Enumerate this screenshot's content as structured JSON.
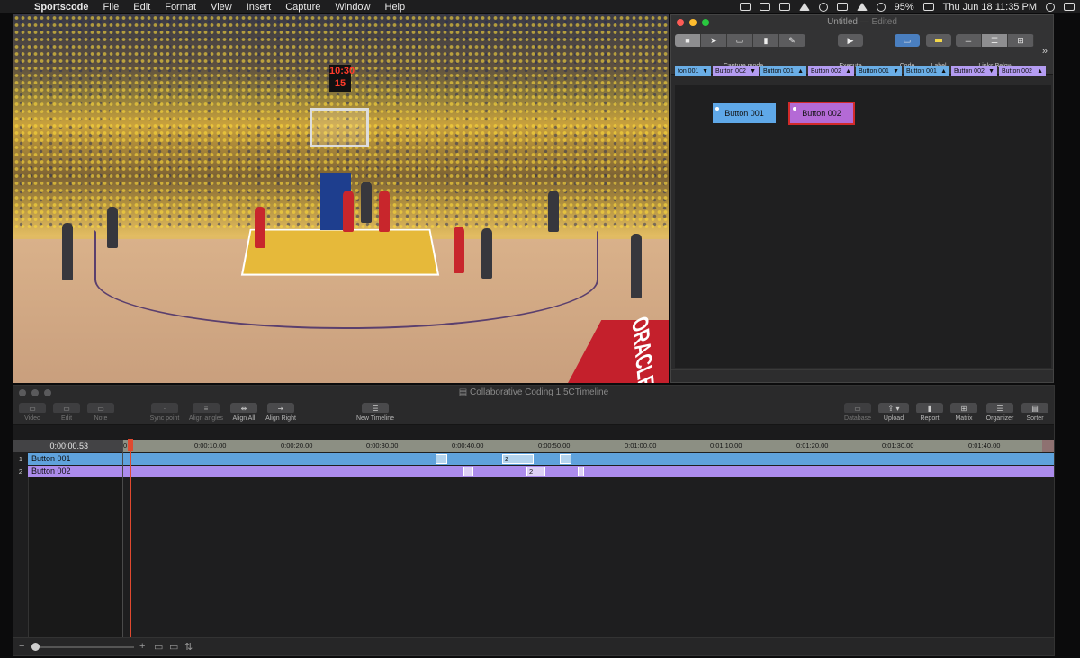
{
  "menubar": {
    "apple_glyph": "",
    "app_name": "Sportscode",
    "items": [
      "File",
      "Edit",
      "Format",
      "View",
      "Insert",
      "Capture",
      "Window",
      "Help"
    ],
    "battery": "95%",
    "datetime": "Thu Jun 18  11:35 PM"
  },
  "video": {
    "scoreboard_time": "10:30",
    "scoreboard_shot": "15",
    "ad_text": "ORACLE"
  },
  "code_window": {
    "title": "Untitled",
    "title_suffix": "— Edited",
    "toolbar": {
      "capture_mode_label": "Capture mode",
      "execute_label": "Execute",
      "code_label": "Code",
      "label_label": "Label",
      "links_below_label": "Links Below",
      "more_glyph": "»"
    },
    "tag_strip": [
      {
        "text": "ton 001",
        "arrow": "▼",
        "color": "blue"
      },
      {
        "text": "Button 002",
        "arrow": "▼",
        "color": "purple"
      },
      {
        "text": "Button 001",
        "arrow": "▲",
        "color": "blue"
      },
      {
        "text": "Button 002",
        "arrow": "▲",
        "color": "purple"
      },
      {
        "text": "Button 001",
        "arrow": "▼",
        "color": "blue"
      },
      {
        "text": "Button 001",
        "arrow": "▲",
        "color": "blue"
      },
      {
        "text": "Button 002",
        "arrow": "▼",
        "color": "purple"
      },
      {
        "text": "Button 002",
        "arrow": "▲",
        "color": "purple"
      }
    ],
    "code_buttons": [
      {
        "label": "Button 001",
        "color": "#5fa8e8",
        "selected": false
      },
      {
        "label": "Button 002",
        "color": "#b46ad6",
        "selected": true
      }
    ]
  },
  "timeline": {
    "title": "Collaborative Coding 1.5CTimeline",
    "toolbar": [
      {
        "label": "Video",
        "enabled": false
      },
      {
        "label": "Edit",
        "enabled": false
      },
      {
        "label": "Note",
        "enabled": false
      },
      {
        "label": "Sync point",
        "enabled": false
      },
      {
        "label": "Align angles",
        "enabled": false
      },
      {
        "label": "Align All",
        "enabled": true
      },
      {
        "label": "Align Right",
        "enabled": true
      },
      {
        "label": "New Timeline",
        "enabled": true
      },
      {
        "label": "Database",
        "enabled": false
      },
      {
        "label": "Upload",
        "enabled": true
      },
      {
        "label": "Report",
        "enabled": true
      },
      {
        "label": "Matrix",
        "enabled": true
      },
      {
        "label": "Organizer",
        "enabled": true
      },
      {
        "label": "Sorter",
        "enabled": true
      }
    ],
    "timecode": "0:00:00.53",
    "ruler": {
      "start_label": "0",
      "labels": [
        "0:00:10.00",
        "0:00:20.00",
        "0:00:30.00",
        "0:00:40.00",
        "0:00:50.00",
        "0:01:00.00",
        "0:01:10.00",
        "0:01:20.00",
        "0:01:30.00",
        "0:01:40.00"
      ]
    },
    "rows": [
      {
        "number": "1",
        "name": "Button 001",
        "color": "blue",
        "instances": [
          {
            "label": ""
          },
          {
            "label": "2"
          },
          {
            "label": ""
          }
        ]
      },
      {
        "number": "2",
        "name": "Button 002",
        "color": "purple",
        "instances": [
          {
            "label": ""
          },
          {
            "label": "2"
          },
          {
            "label": ""
          }
        ]
      }
    ],
    "bottom": {
      "minus": "−",
      "plus": "+",
      "extra_icons": [
        "▭",
        "▭",
        "⇅"
      ]
    }
  }
}
